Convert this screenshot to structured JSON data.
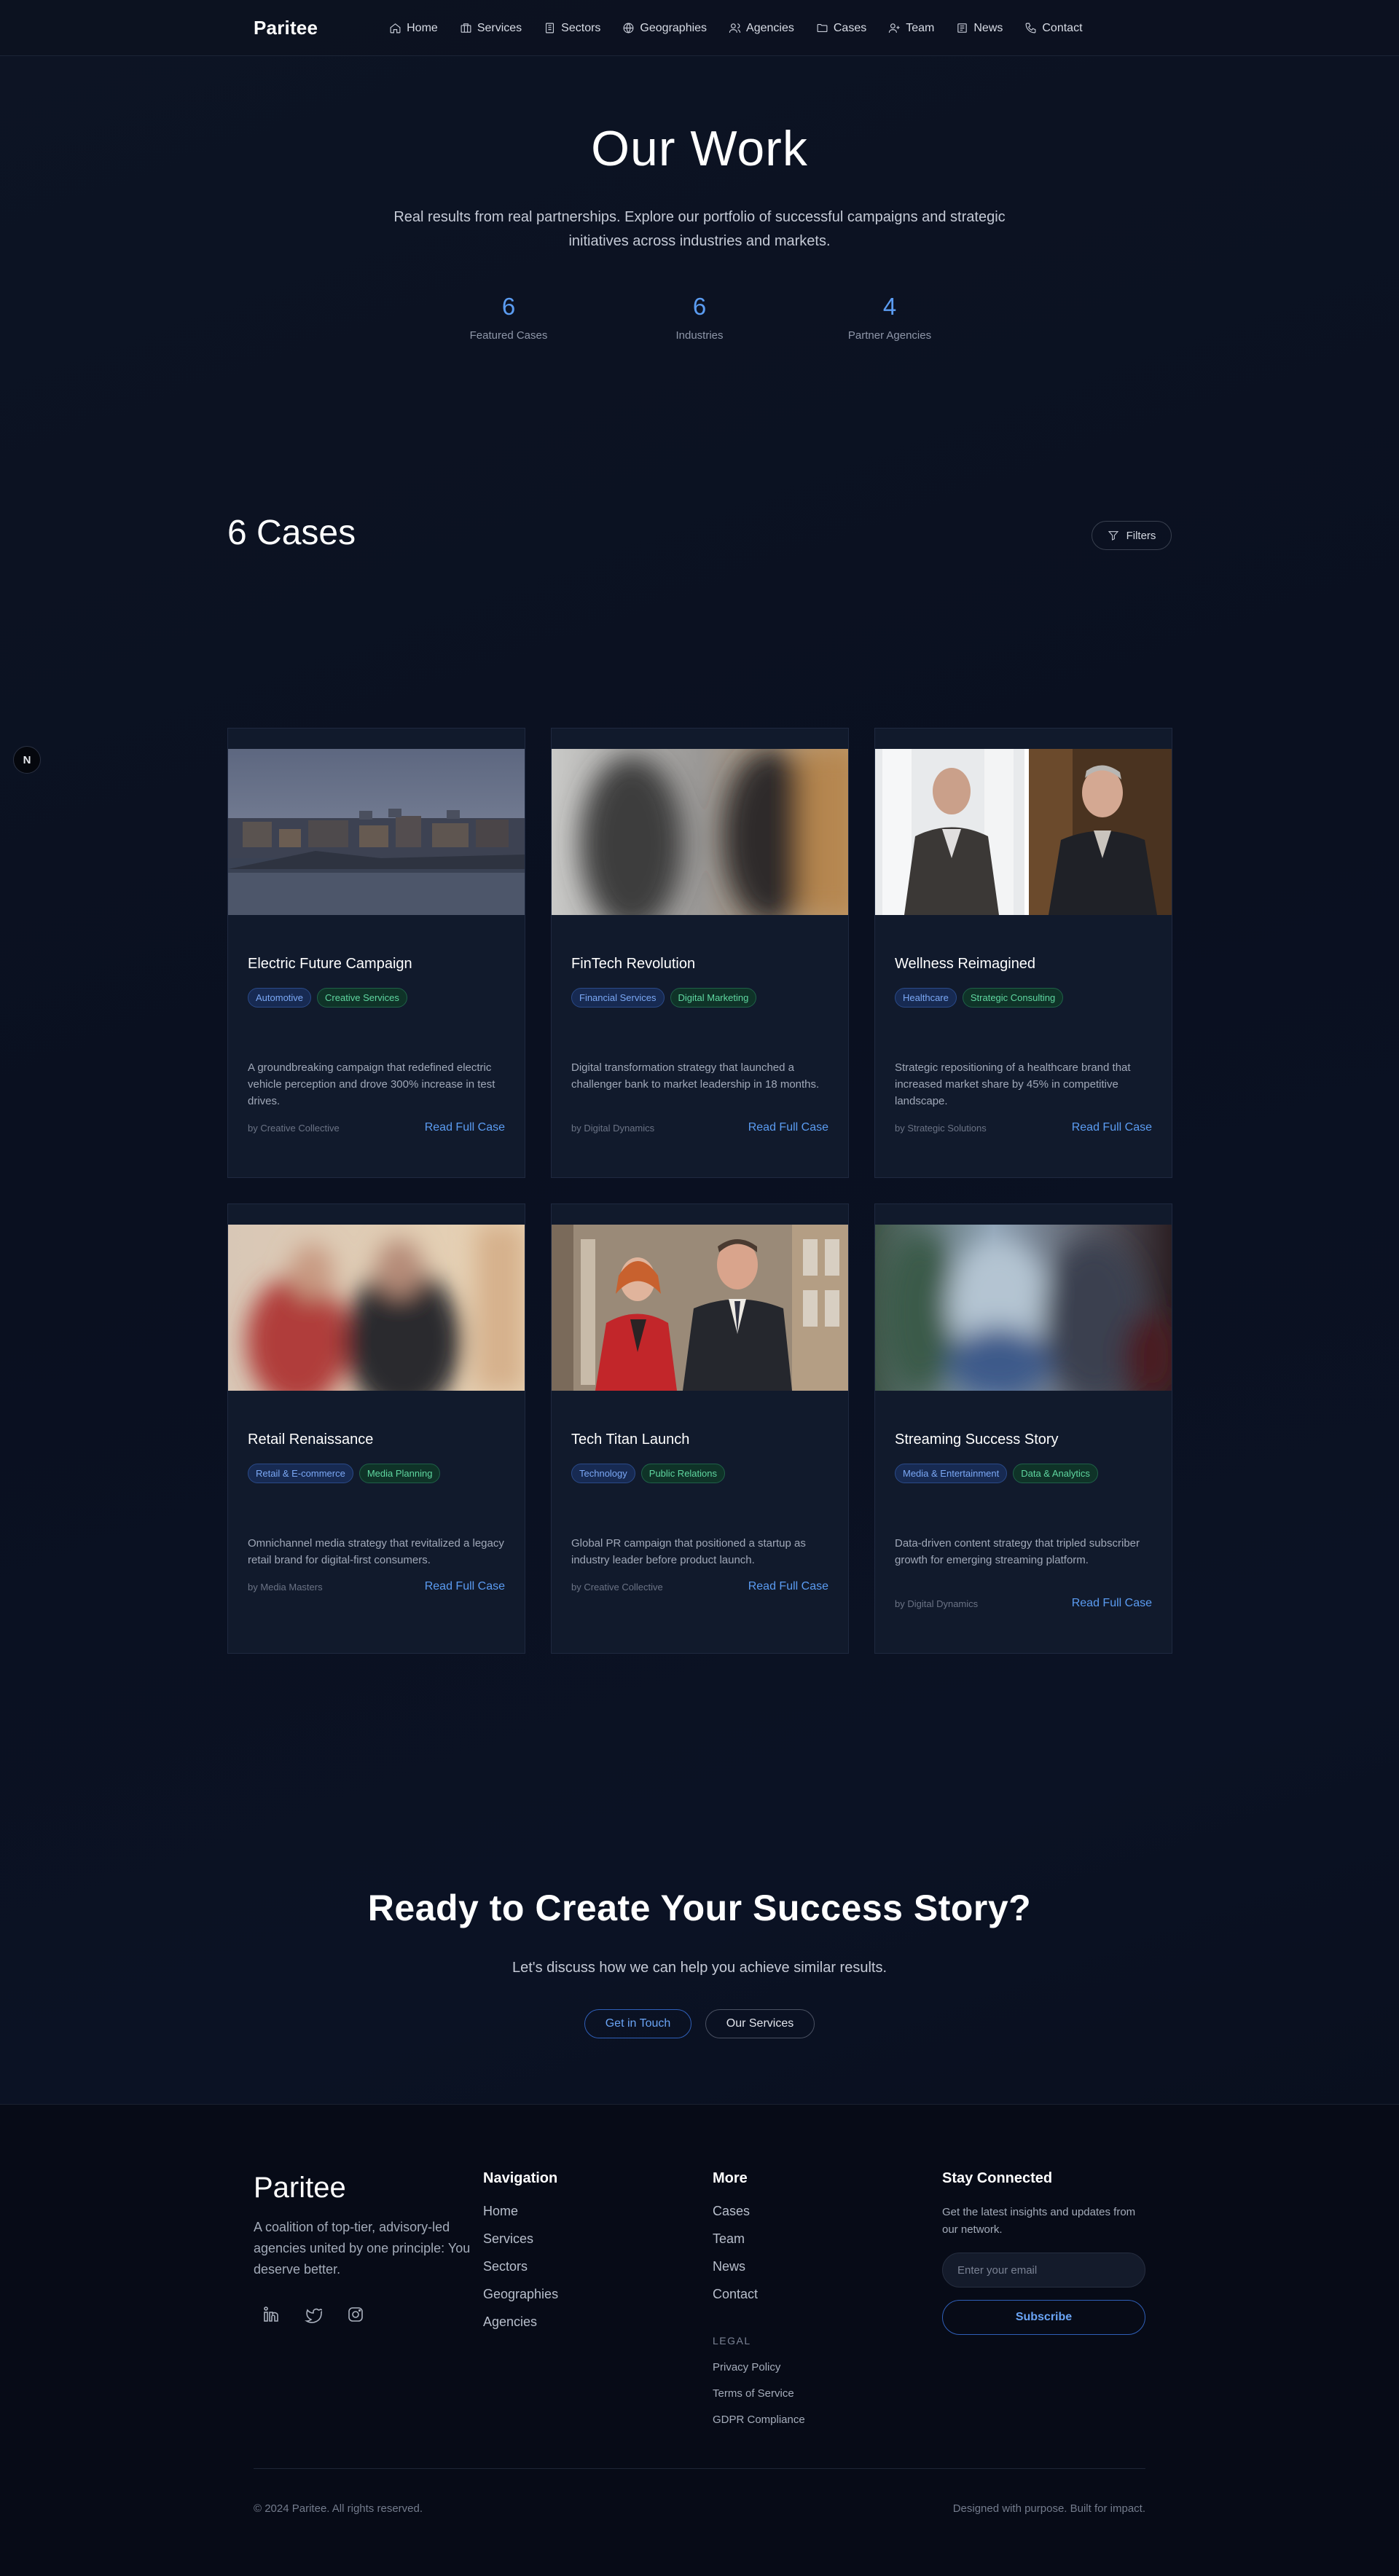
{
  "nav": {
    "brand": "Paritee",
    "links": [
      {
        "label": "Home",
        "icon": "home-icon"
      },
      {
        "label": "Services",
        "icon": "briefcase-icon"
      },
      {
        "label": "Sectors",
        "icon": "building-icon"
      },
      {
        "label": "Geographies",
        "icon": "globe-icon"
      },
      {
        "label": "Agencies",
        "icon": "users-icon"
      },
      {
        "label": "Cases",
        "icon": "folder-icon"
      },
      {
        "label": "Team",
        "icon": "user-plus-icon"
      },
      {
        "label": "News",
        "icon": "newspaper-icon"
      },
      {
        "label": "Contact",
        "icon": "phone-icon"
      }
    ]
  },
  "hero": {
    "title": "Our Work",
    "subtitle": "Real results from real partnerships. Explore our portfolio of successful campaigns and strategic initiatives across industries and markets.",
    "stats": [
      {
        "value": "6",
        "label": "Featured Cases"
      },
      {
        "value": "6",
        "label": "Industries"
      },
      {
        "value": "4",
        "label": "Partner Agencies"
      }
    ]
  },
  "cases_header": {
    "title": "6 Cases",
    "filters_label": "Filters"
  },
  "side_badge": "N",
  "cases": [
    {
      "title": "Electric Future Campaign",
      "tags": [
        "Automotive",
        "Creative Services"
      ],
      "description": "A groundbreaking campaign that redefined electric vehicle perception and drove 300% increase in test drives.",
      "by": "by Creative Collective",
      "cta": "Read Full Case"
    },
    {
      "title": "FinTech Revolution",
      "tags": [
        "Financial Services",
        "Digital Marketing"
      ],
      "description": "Digital transformation strategy that launched a challenger bank to market leadership in 18 months.",
      "by": "by Digital Dynamics",
      "cta": "Read Full Case"
    },
    {
      "title": "Wellness Reimagined",
      "tags": [
        "Healthcare",
        "Strategic Consulting"
      ],
      "description": "Strategic repositioning of a healthcare brand that increased market share by 45% in competitive landscape.",
      "by": "by Strategic Solutions",
      "cta": "Read Full Case"
    },
    {
      "title": "Retail Renaissance",
      "tags": [
        "Retail & E-commerce",
        "Media Planning"
      ],
      "description": "Omnichannel media strategy that revitalized a legacy retail brand for digital-first consumers.",
      "by": "by Media Masters",
      "cta": "Read Full Case"
    },
    {
      "title": "Tech Titan Launch",
      "tags": [
        "Technology",
        "Public Relations"
      ],
      "description": "Global PR campaign that positioned a startup as industry leader before product launch.",
      "by": "by Creative Collective",
      "cta": "Read Full Case"
    },
    {
      "title": "Streaming Success Story",
      "tags": [
        "Media & Entertainment",
        "Data & Analytics"
      ],
      "description": "Data-driven content strategy that tripled subscriber growth for emerging streaming platform.",
      "by": "by Digital Dynamics",
      "cta": "Read Full Case"
    }
  ],
  "cta": {
    "title": "Ready to Create Your Success Story?",
    "subtitle": "Let's discuss how we can help you achieve similar results.",
    "primary": "Get in Touch",
    "secondary": "Our Services"
  },
  "footer": {
    "brand": "Paritee",
    "tagline": "A coalition of top-tier, advisory-led agencies united by one principle: You deserve better.",
    "social": [
      "linkedin-icon",
      "twitter-icon",
      "instagram-icon"
    ],
    "nav_title": "Navigation",
    "nav_links": [
      "Home",
      "Services",
      "Sectors",
      "Geographies",
      "Agencies"
    ],
    "more_title": "More",
    "more_links": [
      "Cases",
      "Team",
      "News",
      "Contact"
    ],
    "legal_title": "LEGAL",
    "legal_links": [
      "Privacy Policy",
      "Terms of Service",
      "GDPR Compliance"
    ],
    "stay_title": "Stay Connected",
    "stay_text": "Get the latest insights and updates from our network.",
    "email_placeholder": "Enter your email",
    "subscribe": "Subscribe",
    "copyright": "© 2024 Paritee. All rights reserved.",
    "designed": "Designed with purpose. Built for impact."
  },
  "colors": {
    "accent": "#5b9cf2",
    "background": "#0a1020",
    "card": "#111a2c",
    "tag_blue": "#7ba8f5",
    "tag_green": "#5fd7a0"
  }
}
